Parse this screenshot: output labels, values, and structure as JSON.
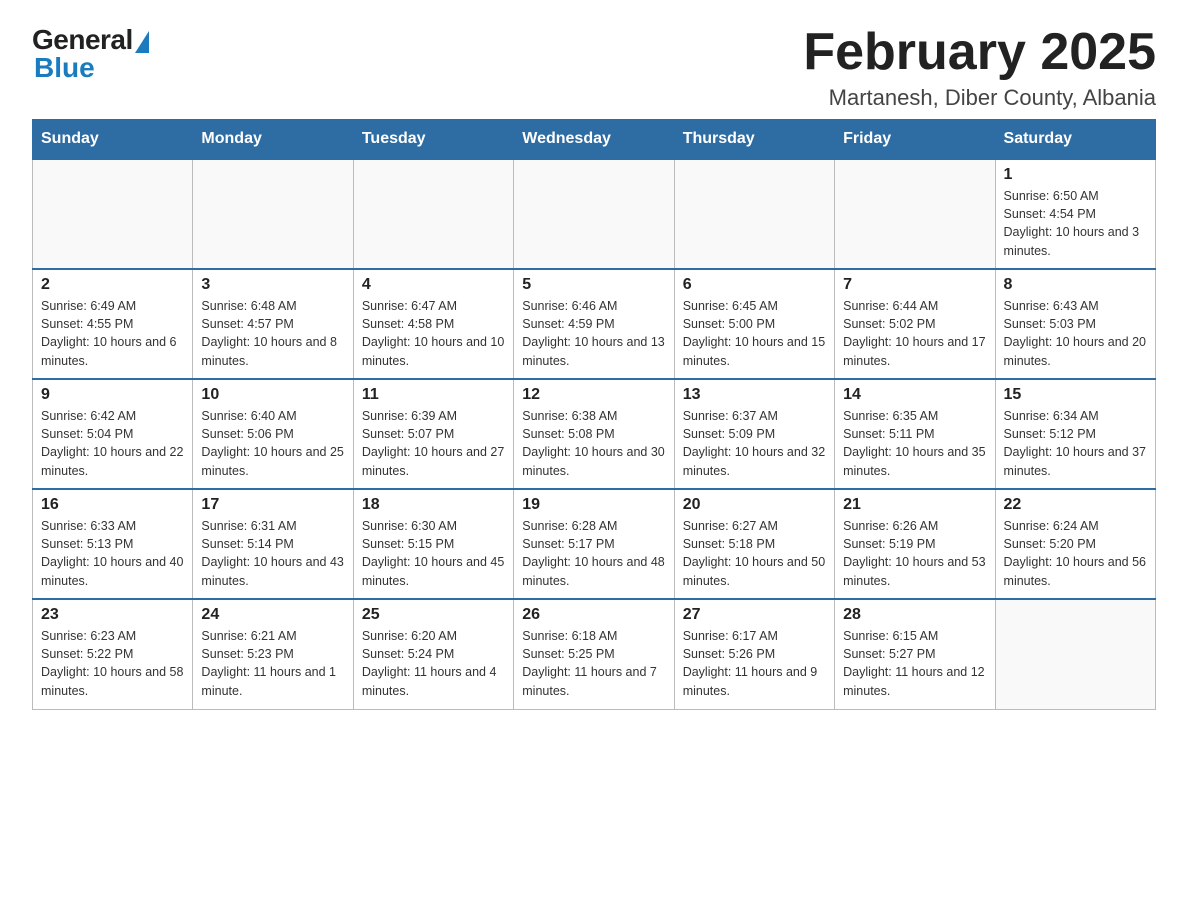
{
  "header": {
    "logo_general": "General",
    "logo_blue": "Blue",
    "month_title": "February 2025",
    "location": "Martanesh, Diber County, Albania"
  },
  "days_of_week": [
    "Sunday",
    "Monday",
    "Tuesday",
    "Wednesday",
    "Thursday",
    "Friday",
    "Saturday"
  ],
  "weeks": [
    [
      {
        "day": "",
        "info": ""
      },
      {
        "day": "",
        "info": ""
      },
      {
        "day": "",
        "info": ""
      },
      {
        "day": "",
        "info": ""
      },
      {
        "day": "",
        "info": ""
      },
      {
        "day": "",
        "info": ""
      },
      {
        "day": "1",
        "info": "Sunrise: 6:50 AM\nSunset: 4:54 PM\nDaylight: 10 hours and 3 minutes."
      }
    ],
    [
      {
        "day": "2",
        "info": "Sunrise: 6:49 AM\nSunset: 4:55 PM\nDaylight: 10 hours and 6 minutes."
      },
      {
        "day": "3",
        "info": "Sunrise: 6:48 AM\nSunset: 4:57 PM\nDaylight: 10 hours and 8 minutes."
      },
      {
        "day": "4",
        "info": "Sunrise: 6:47 AM\nSunset: 4:58 PM\nDaylight: 10 hours and 10 minutes."
      },
      {
        "day": "5",
        "info": "Sunrise: 6:46 AM\nSunset: 4:59 PM\nDaylight: 10 hours and 13 minutes."
      },
      {
        "day": "6",
        "info": "Sunrise: 6:45 AM\nSunset: 5:00 PM\nDaylight: 10 hours and 15 minutes."
      },
      {
        "day": "7",
        "info": "Sunrise: 6:44 AM\nSunset: 5:02 PM\nDaylight: 10 hours and 17 minutes."
      },
      {
        "day": "8",
        "info": "Sunrise: 6:43 AM\nSunset: 5:03 PM\nDaylight: 10 hours and 20 minutes."
      }
    ],
    [
      {
        "day": "9",
        "info": "Sunrise: 6:42 AM\nSunset: 5:04 PM\nDaylight: 10 hours and 22 minutes."
      },
      {
        "day": "10",
        "info": "Sunrise: 6:40 AM\nSunset: 5:06 PM\nDaylight: 10 hours and 25 minutes."
      },
      {
        "day": "11",
        "info": "Sunrise: 6:39 AM\nSunset: 5:07 PM\nDaylight: 10 hours and 27 minutes."
      },
      {
        "day": "12",
        "info": "Sunrise: 6:38 AM\nSunset: 5:08 PM\nDaylight: 10 hours and 30 minutes."
      },
      {
        "day": "13",
        "info": "Sunrise: 6:37 AM\nSunset: 5:09 PM\nDaylight: 10 hours and 32 minutes."
      },
      {
        "day": "14",
        "info": "Sunrise: 6:35 AM\nSunset: 5:11 PM\nDaylight: 10 hours and 35 minutes."
      },
      {
        "day": "15",
        "info": "Sunrise: 6:34 AM\nSunset: 5:12 PM\nDaylight: 10 hours and 37 minutes."
      }
    ],
    [
      {
        "day": "16",
        "info": "Sunrise: 6:33 AM\nSunset: 5:13 PM\nDaylight: 10 hours and 40 minutes."
      },
      {
        "day": "17",
        "info": "Sunrise: 6:31 AM\nSunset: 5:14 PM\nDaylight: 10 hours and 43 minutes."
      },
      {
        "day": "18",
        "info": "Sunrise: 6:30 AM\nSunset: 5:15 PM\nDaylight: 10 hours and 45 minutes."
      },
      {
        "day": "19",
        "info": "Sunrise: 6:28 AM\nSunset: 5:17 PM\nDaylight: 10 hours and 48 minutes."
      },
      {
        "day": "20",
        "info": "Sunrise: 6:27 AM\nSunset: 5:18 PM\nDaylight: 10 hours and 50 minutes."
      },
      {
        "day": "21",
        "info": "Sunrise: 6:26 AM\nSunset: 5:19 PM\nDaylight: 10 hours and 53 minutes."
      },
      {
        "day": "22",
        "info": "Sunrise: 6:24 AM\nSunset: 5:20 PM\nDaylight: 10 hours and 56 minutes."
      }
    ],
    [
      {
        "day": "23",
        "info": "Sunrise: 6:23 AM\nSunset: 5:22 PM\nDaylight: 10 hours and 58 minutes."
      },
      {
        "day": "24",
        "info": "Sunrise: 6:21 AM\nSunset: 5:23 PM\nDaylight: 11 hours and 1 minute."
      },
      {
        "day": "25",
        "info": "Sunrise: 6:20 AM\nSunset: 5:24 PM\nDaylight: 11 hours and 4 minutes."
      },
      {
        "day": "26",
        "info": "Sunrise: 6:18 AM\nSunset: 5:25 PM\nDaylight: 11 hours and 7 minutes."
      },
      {
        "day": "27",
        "info": "Sunrise: 6:17 AM\nSunset: 5:26 PM\nDaylight: 11 hours and 9 minutes."
      },
      {
        "day": "28",
        "info": "Sunrise: 6:15 AM\nSunset: 5:27 PM\nDaylight: 11 hours and 12 minutes."
      },
      {
        "day": "",
        "info": ""
      }
    ]
  ],
  "colors": {
    "header_bg": "#2e6da4",
    "header_text": "#ffffff",
    "accent_blue": "#1a7bbf"
  }
}
